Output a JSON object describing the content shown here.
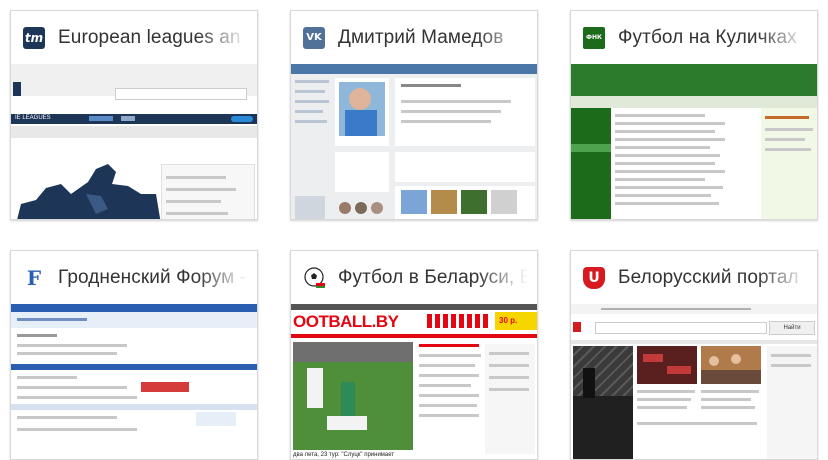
{
  "tiles": [
    {
      "title": "European leagues an",
      "favicon_text": "tm"
    },
    {
      "title": "Дмитрий Мамедов",
      "favicon_text": "VK"
    },
    {
      "title": "Футбол на Куличках",
      "favicon_text": "ФНК"
    },
    {
      "title": "Гродненский Форум -",
      "favicon_text": "F"
    },
    {
      "title": "Футбол в Беларуси, Е",
      "favicon_text": ""
    },
    {
      "title": "Белорусский портал",
      "favicon_text": "U"
    }
  ],
  "previews": {
    "tm_nav": "IE LEAGUES",
    "football_logo": "OOTBALL.BY",
    "football_promo": "30 р.",
    "football_caption": "два лета, 23 тур: \"Слуцк\" принимает",
    "tut_search_button": "Найти"
  },
  "colors": {
    "tm_blue": "#1d3557",
    "vk_blue": "#507299",
    "fnk_green": "#1b6b1b",
    "grodno_blue": "#2a5fb0",
    "football_red": "#e30613",
    "tut_red": "#d71920"
  }
}
